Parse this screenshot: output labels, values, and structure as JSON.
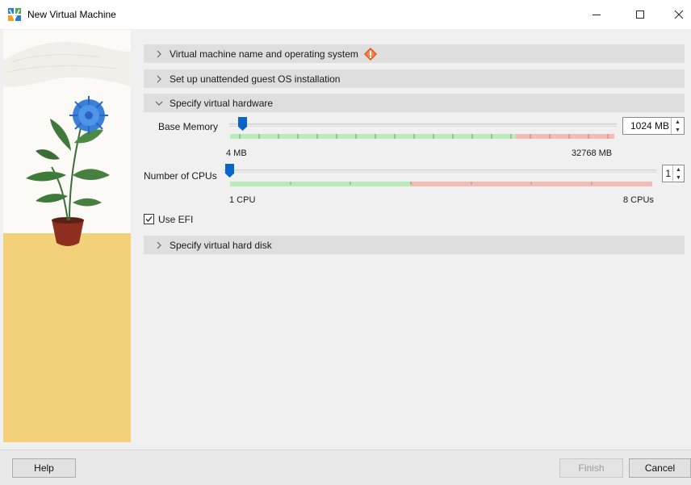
{
  "window": {
    "title": "New Virtual Machine",
    "controls": [
      "minimize",
      "maximize",
      "close"
    ]
  },
  "sections": [
    {
      "label": "Virtual machine name and operating system",
      "expanded": false,
      "warning": true
    },
    {
      "label": "Set up unattended guest OS installation",
      "expanded": false
    },
    {
      "label": "Specify virtual hardware",
      "expanded": true
    },
    {
      "label": "Specify virtual hard disk",
      "expanded": false
    }
  ],
  "hardware": {
    "memory": {
      "label": "Base Memory",
      "value": "1024 MB",
      "min_label": "4 MB",
      "max_label": "32768 MB"
    },
    "cpus": {
      "label": "Number of CPUs",
      "value": "1",
      "min_label": "1 CPU",
      "max_label": "8 CPUs"
    },
    "efi": {
      "label": "Use EFI",
      "checked": true
    }
  },
  "buttons": {
    "help": "Help",
    "finish": "Finish",
    "cancel": "Cancel"
  },
  "colors": {
    "accent": "#0a64c8",
    "scale_green": "#b9ecb9",
    "scale_red": "#f5bcb4",
    "warning": "#e2552c",
    "art_floor": "#f3d17a"
  }
}
